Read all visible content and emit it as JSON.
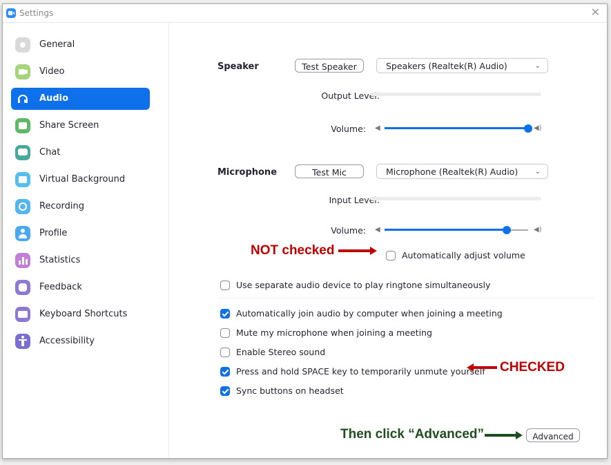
{
  "window": {
    "title": "Settings",
    "close_icon": "close-icon"
  },
  "colors": {
    "accent": "#0e71eb",
    "annotation_red": "#c00000",
    "annotation_green": "#1e4d1e"
  },
  "sidebar": {
    "items": [
      {
        "label": "General",
        "icon": "gear-icon",
        "color": "#d9d9d9"
      },
      {
        "label": "Video",
        "icon": "video-camera-icon",
        "color": "#a6d47c"
      },
      {
        "label": "Audio",
        "icon": "headphones-icon",
        "color": "#0e71eb",
        "active": true
      },
      {
        "label": "Share Screen",
        "icon": "share-screen-icon",
        "color": "#5fb865"
      },
      {
        "label": "Chat",
        "icon": "chat-bubble-icon",
        "color": "#47a89c"
      },
      {
        "label": "Virtual Background",
        "icon": "virtual-background-icon",
        "color": "#55c0ee"
      },
      {
        "label": "Recording",
        "icon": "recording-icon",
        "color": "#55b6ee"
      },
      {
        "label": "Profile",
        "icon": "profile-icon",
        "color": "#4ba8ee"
      },
      {
        "label": "Statistics",
        "icon": "statistics-icon",
        "color": "#c27fd6"
      },
      {
        "label": "Feedback",
        "icon": "feedback-smiley-icon",
        "color": "#8d78d4"
      },
      {
        "label": "Keyboard Shortcuts",
        "icon": "keyboard-icon",
        "color": "#8d78d4"
      },
      {
        "label": "Accessibility",
        "icon": "accessibility-icon",
        "color": "#7a6fd0"
      }
    ]
  },
  "speaker": {
    "section_label": "Speaker",
    "test_button": "Test Speaker",
    "device": "Speakers (Realtek(R) Audio)",
    "output_level_label": "Output Level:",
    "output_level": 0,
    "volume_label": "Volume:",
    "volume_percent": 100
  },
  "microphone": {
    "section_label": "Microphone",
    "test_button": "Test Mic",
    "device": "Microphone (Realtek(R) Audio)",
    "input_level_label": "Input Level:",
    "input_level": 0,
    "volume_label": "Volume:",
    "volume_percent": 85,
    "auto_adjust": {
      "label": "Automatically adjust volume",
      "checked": false
    }
  },
  "options": [
    {
      "label": "Use separate audio device to play ringtone simultaneously",
      "checked": false
    },
    {
      "label": "Automatically join audio by computer when joining a meeting",
      "checked": true
    },
    {
      "label": "Mute my microphone when joining a meeting",
      "checked": false
    },
    {
      "label": "Enable Stereo sound",
      "checked": false
    },
    {
      "label": "Press and hold SPACE key to temporarily unmute yourself",
      "checked": true
    },
    {
      "label": "Sync buttons on headset",
      "checked": true
    }
  ],
  "advanced_button": "Advanced",
  "annotations": {
    "not_checked": "NOT checked",
    "checked": "CHECKED",
    "then_click": "Then click “Advanced”"
  }
}
